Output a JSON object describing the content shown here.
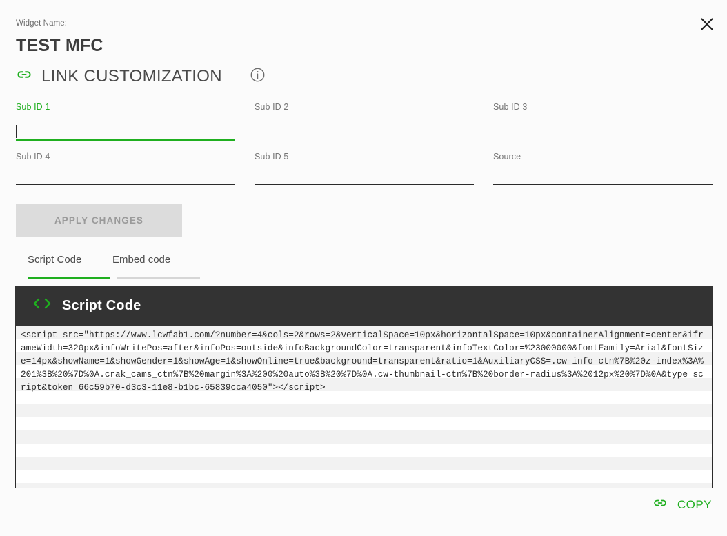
{
  "header": {
    "widget_name_label": "Widget Name:",
    "widget_title": "TEST MFC",
    "section_title": "LINK CUSTOMIZATION",
    "link_icon": "link-icon",
    "info_icon": "info-icon",
    "close_icon": "close-icon"
  },
  "colors": {
    "accent_green": "#1faf1f",
    "code_header_bg": "#333333",
    "disabled_button_bg": "#dcdcdc",
    "disabled_button_text": "#9a9a9a",
    "stripe": "#f2f2f2",
    "page_bg": "#fbfbfb"
  },
  "form": {
    "fields": [
      {
        "label": "Sub ID 1",
        "value": "",
        "placeholder": "",
        "focused": true
      },
      {
        "label": "Sub ID 2",
        "value": "",
        "placeholder": "",
        "focused": false
      },
      {
        "label": "Sub ID 3",
        "value": "",
        "placeholder": "",
        "focused": false
      },
      {
        "label": "Sub ID 4",
        "value": "",
        "placeholder": "",
        "focused": false
      },
      {
        "label": "Sub ID 5",
        "value": "",
        "placeholder": "",
        "focused": false
      },
      {
        "label": "Source",
        "value": "",
        "placeholder": "",
        "focused": false
      }
    ],
    "apply_button": {
      "label": "APPLY CHANGES",
      "disabled": true
    }
  },
  "tabs": {
    "items": [
      {
        "label": "Script Code",
        "active": true
      },
      {
        "label": "Embed code",
        "active": false
      }
    ]
  },
  "code_panel": {
    "icon": "code-brackets-icon",
    "title": "Script Code",
    "code": "<script src=\"https://www.lcwfab1.com/?number=4&cols=2&rows=2&verticalSpace=10px&horizontalSpace=10px&containerAlignment=center&iframeWidth=320px&infoWritePos=after&infoPos=outside&infoBackgroundColor=transparent&infoTextColor=%23000000&fontFamily=Arial&fontSize=14px&showName=1&showGender=1&showAge=1&showOnline=true&background=transparent&ratio=1&AuxiliaryCSS=.cw-info-ctn%7B%20z-index%3A%201%3B%20%7D%0A.crak_cams_ctn%7B%20margin%3A%200%20auto%3B%20%7D%0A.cw-thumbnail-ctn%7B%20border-radius%3A%2012px%20%7D%0A&type=script&token=66c59b70-d3c3-11e8-b1bc-65839cca4050\"></scr"
  },
  "copy": {
    "label": "COPY",
    "icon": "link-icon"
  }
}
